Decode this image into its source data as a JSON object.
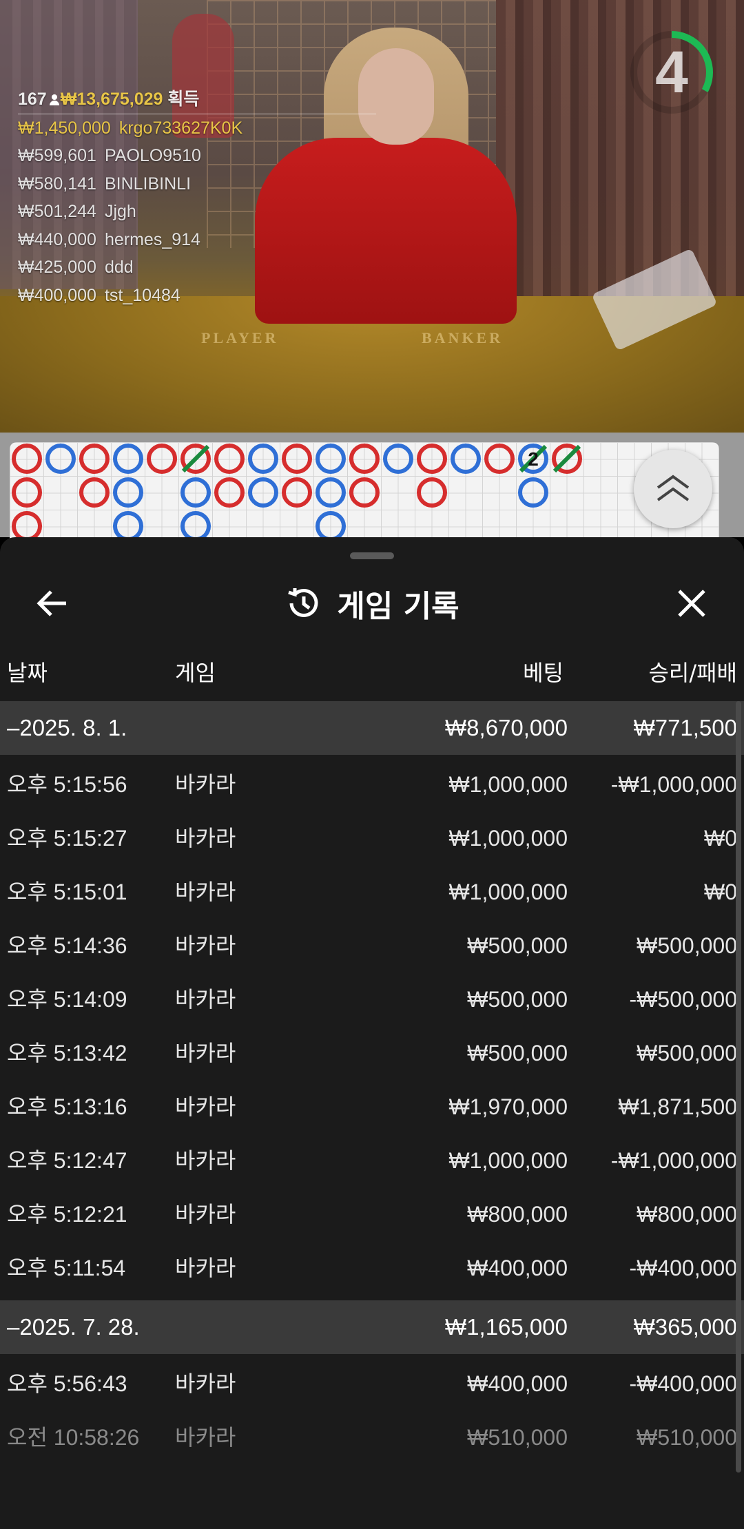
{
  "video": {
    "players_count": "167",
    "total_amount": "₩13,675,029",
    "total_label": "획득",
    "table_labels": {
      "player": "PLAYER",
      "banker": "BANKER"
    },
    "winners": [
      {
        "amount": "₩1,450,000",
        "name": "krgo733627K0K"
      },
      {
        "amount": "₩599,601",
        "name": "PAOLO9510"
      },
      {
        "amount": "₩580,141",
        "name": "BINLIBINLI"
      },
      {
        "amount": "₩501,244",
        "name": "Jjgh"
      },
      {
        "amount": "₩440,000",
        "name": "hermes_914"
      },
      {
        "amount": "₩425,000",
        "name": "ddd"
      },
      {
        "amount": "₩400,000",
        "name": "tst_10484"
      }
    ],
    "countdown": "4",
    "countdown_fraction": 0.33,
    "colors": {
      "gold": "#e8c547",
      "timer": "#1db954"
    }
  },
  "roadmap": {
    "colors": {
      "banker": "#d62d2d",
      "player": "#2f6fd6",
      "tie": "#1a8a3e"
    },
    "tie_label": "2",
    "columns": [
      [
        "B",
        "B",
        "B"
      ],
      [
        "P"
      ],
      [
        "B",
        "B"
      ],
      [
        "P",
        "P",
        "P"
      ],
      [
        "B"
      ],
      [
        "B*",
        "P",
        "P"
      ],
      [
        "B",
        "B"
      ],
      [
        "P",
        "P"
      ],
      [
        "B",
        "B"
      ],
      [
        "P",
        "P",
        "P"
      ],
      [
        "B",
        "B"
      ],
      [
        "P"
      ],
      [
        "B",
        "B"
      ],
      [
        "P"
      ],
      [
        "B"
      ],
      [
        "P2",
        "P"
      ],
      [
        "B*"
      ]
    ]
  },
  "history": {
    "title": "게임 기록",
    "columns": {
      "date": "날짜",
      "game": "게임",
      "bet": "베팅",
      "result": "승리/패배"
    },
    "groups": [
      {
        "date": "–2025. 8. 1.",
        "bet_total": "₩8,670,000",
        "result_total": "₩771,500",
        "rows": [
          {
            "time": "오후 5:15:56",
            "game": "바카라",
            "bet": "₩1,000,000",
            "result": "-₩1,000,000"
          },
          {
            "time": "오후 5:15:27",
            "game": "바카라",
            "bet": "₩1,000,000",
            "result": "₩0"
          },
          {
            "time": "오후 5:15:01",
            "game": "바카라",
            "bet": "₩1,000,000",
            "result": "₩0"
          },
          {
            "time": "오후 5:14:36",
            "game": "바카라",
            "bet": "₩500,000",
            "result": "₩500,000"
          },
          {
            "time": "오후 5:14:09",
            "game": "바카라",
            "bet": "₩500,000",
            "result": "-₩500,000"
          },
          {
            "time": "오후 5:13:42",
            "game": "바카라",
            "bet": "₩500,000",
            "result": "₩500,000"
          },
          {
            "time": "오후 5:13:16",
            "game": "바카라",
            "bet": "₩1,970,000",
            "result": "₩1,871,500"
          },
          {
            "time": "오후 5:12:47",
            "game": "바카라",
            "bet": "₩1,000,000",
            "result": "-₩1,000,000"
          },
          {
            "time": "오후 5:12:21",
            "game": "바카라",
            "bet": "₩800,000",
            "result": "₩800,000"
          },
          {
            "time": "오후 5:11:54",
            "game": "바카라",
            "bet": "₩400,000",
            "result": "-₩400,000"
          }
        ]
      },
      {
        "date": "–2025. 7. 28.",
        "bet_total": "₩1,165,000",
        "result_total": "₩365,000",
        "rows": [
          {
            "time": "오후 5:56:43",
            "game": "바카라",
            "bet": "₩400,000",
            "result": "-₩400,000"
          },
          {
            "time": "오전 10:58:26",
            "game": "바카라",
            "bet": "₩510,000",
            "result": "₩510,000"
          }
        ]
      }
    ]
  }
}
